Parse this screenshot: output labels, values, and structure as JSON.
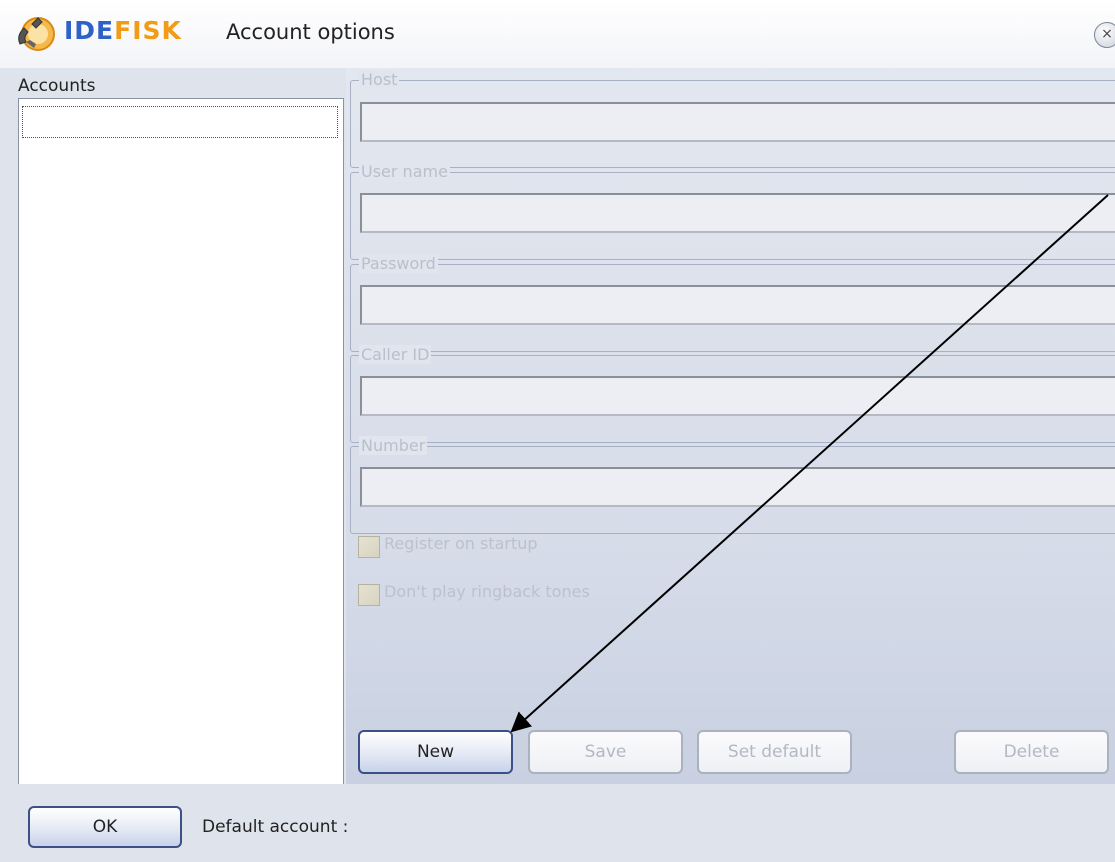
{
  "window": {
    "brand_part1": "IDE",
    "brand_part2": "FISK",
    "title": "Account options",
    "close_glyph": "×",
    "logo_icon": "phone-handset-icon",
    "close_icon": "close-icon"
  },
  "accounts": {
    "label": "Accounts",
    "items": []
  },
  "form": {
    "host": {
      "label": "Host",
      "value": ""
    },
    "username": {
      "label": "User name",
      "value": ""
    },
    "password": {
      "label": "Password",
      "value": ""
    },
    "caller_id": {
      "label": "Caller ID",
      "value": ""
    },
    "number": {
      "label": "Number",
      "value": ""
    },
    "register_on_startup": {
      "label": "Register on startup",
      "checked": false,
      "enabled": false
    },
    "no_ringback": {
      "label": "Don't play ringback tones",
      "checked": false,
      "enabled": false
    }
  },
  "buttons": {
    "new": "New",
    "save": "Save",
    "set_default": "Set default",
    "delete": "Delete",
    "ok": "OK"
  },
  "footer": {
    "default_account_label": "Default account :",
    "default_account_value": ""
  },
  "colors": {
    "brand_blue": "#2e62c8",
    "brand_orange": "#f19c16",
    "annotation_arrow": "#000000"
  }
}
